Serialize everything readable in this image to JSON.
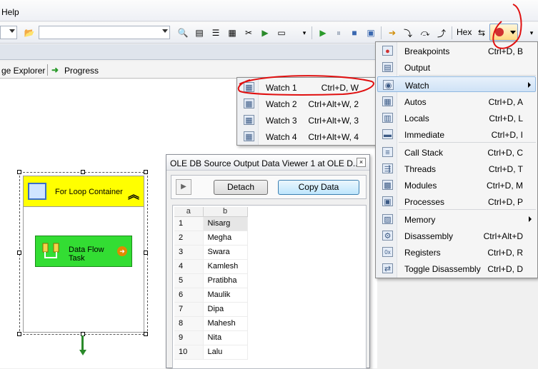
{
  "menubar": {
    "help_label": "Help"
  },
  "toolbar": {
    "hex_label": "Hex"
  },
  "tabs": [
    {
      "label": "ge Explorer"
    },
    {
      "label": "Progress"
    }
  ],
  "designer": {
    "container_label": "For Loop Container",
    "task_label": "Data Flow Task"
  },
  "dataviewer": {
    "title": "OLE DB Source Output Data Viewer 1 at OLE D...",
    "close_label": "×",
    "detach_label": "Detach",
    "copy_label": "Copy Data",
    "columns": [
      "a",
      "b"
    ],
    "rows": [
      [
        "1",
        "Nisarg"
      ],
      [
        "2",
        "Megha"
      ],
      [
        "3",
        "Swara"
      ],
      [
        "4",
        "Kamlesh"
      ],
      [
        "5",
        "Pratibha"
      ],
      [
        "6",
        "Maulik"
      ],
      [
        "7",
        "Dipa"
      ],
      [
        "8",
        "Mahesh"
      ],
      [
        "9",
        "Nita"
      ],
      [
        "10",
        "Lalu"
      ]
    ]
  },
  "debug_menu": {
    "items": [
      {
        "label": "Breakpoints",
        "shortcut": "Ctrl+D, B",
        "icon": "breakpoint-icon"
      },
      {
        "label": "Output",
        "shortcut": "",
        "icon": "output-icon"
      },
      {
        "label": "Watch",
        "shortcut": "",
        "icon": "watch-icon",
        "submenu": true
      },
      {
        "label": "Autos",
        "shortcut": "Ctrl+D, A",
        "icon": "autos-icon"
      },
      {
        "label": "Locals",
        "shortcut": "Ctrl+D, L",
        "icon": "locals-icon"
      },
      {
        "label": "Immediate",
        "shortcut": "Ctrl+D, I",
        "icon": "immediate-icon"
      },
      {
        "label": "Call Stack",
        "shortcut": "Ctrl+D, C",
        "icon": "callstack-icon"
      },
      {
        "label": "Threads",
        "shortcut": "Ctrl+D, T",
        "icon": "threads-icon"
      },
      {
        "label": "Modules",
        "shortcut": "Ctrl+D, M",
        "icon": "modules-icon"
      },
      {
        "label": "Processes",
        "shortcut": "Ctrl+D, P",
        "icon": "processes-icon"
      },
      {
        "label": "Memory",
        "shortcut": "",
        "icon": "memory-icon",
        "submenu": true
      },
      {
        "label": "Disassembly",
        "shortcut": "Ctrl+Alt+D",
        "icon": "disassembly-icon"
      },
      {
        "label": "Registers",
        "shortcut": "Ctrl+D, R",
        "icon": "registers-icon"
      },
      {
        "label": "Toggle Disassembly",
        "shortcut": "Ctrl+D, D",
        "icon": "toggle-disassembly-icon"
      }
    ]
  },
  "watch_submenu": {
    "items": [
      {
        "label": "Watch 1",
        "shortcut": "Ctrl+D, W"
      },
      {
        "label": "Watch 2",
        "shortcut": "Ctrl+Alt+W, 2"
      },
      {
        "label": "Watch 3",
        "shortcut": "Ctrl+Alt+W, 3"
      },
      {
        "label": "Watch 4",
        "shortcut": "Ctrl+Alt+W, 4"
      }
    ]
  },
  "colors": {
    "annotation_red": "#e01010",
    "container_yellow": "#ffff00",
    "task_green": "#33dd33",
    "menu_highlight": "#cfe2f6"
  }
}
